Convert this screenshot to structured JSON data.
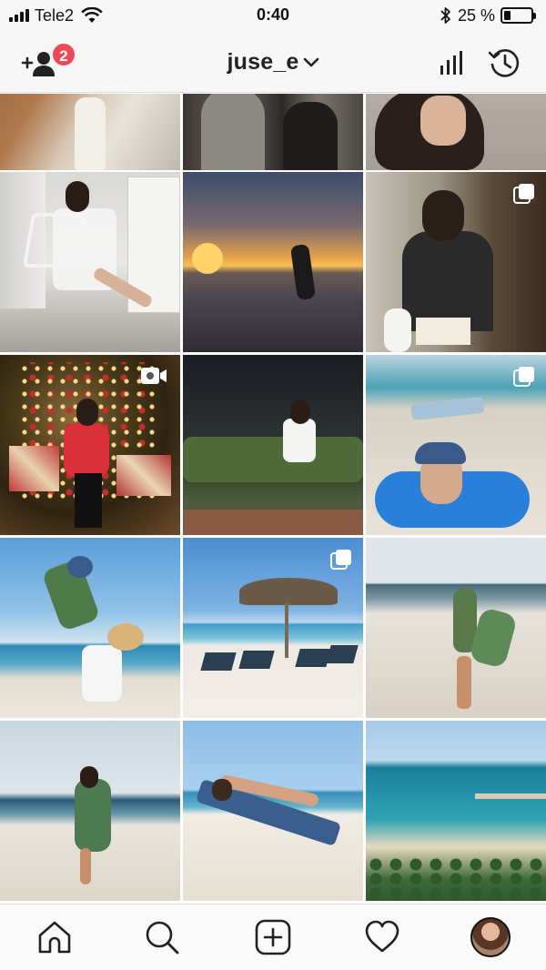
{
  "status_bar": {
    "carrier": "Tele2",
    "time": "0:40",
    "battery_percent": "25 %",
    "battery_level": 0.25
  },
  "header": {
    "username": "juse_e",
    "notification_count": "2",
    "icons": [
      "add-user-icon",
      "chevron-down-icon",
      "bar-chart-icon",
      "history-icon"
    ]
  },
  "grid": {
    "columns": 3,
    "posts": [
      {
        "row": 0,
        "col": 0,
        "desc": "interior",
        "type": "photo"
      },
      {
        "row": 0,
        "col": 1,
        "desc": "people",
        "type": "photo"
      },
      {
        "row": 0,
        "col": 2,
        "desc": "portrait",
        "type": "photo"
      },
      {
        "row": 1,
        "col": 0,
        "desc": "chair-portrait",
        "type": "photo"
      },
      {
        "row": 1,
        "col": 1,
        "desc": "sunset-beach",
        "type": "photo"
      },
      {
        "row": 1,
        "col": 2,
        "desc": "mirror-selfie",
        "type": "carousel"
      },
      {
        "row": 2,
        "col": 0,
        "desc": "christmas-tree",
        "type": "video"
      },
      {
        "row": 2,
        "col": 1,
        "desc": "night-palms",
        "type": "photo"
      },
      {
        "row": 2,
        "col": 2,
        "desc": "baby-pool",
        "type": "carousel"
      },
      {
        "row": 3,
        "col": 0,
        "desc": "father-child",
        "type": "photo"
      },
      {
        "row": 3,
        "col": 1,
        "desc": "beach-umbrella",
        "type": "carousel"
      },
      {
        "row": 3,
        "col": 2,
        "desc": "beach-arms-up",
        "type": "photo"
      },
      {
        "row": 4,
        "col": 0,
        "desc": "beach-walk",
        "type": "photo"
      },
      {
        "row": 4,
        "col": 1,
        "desc": "sunbed",
        "type": "photo"
      },
      {
        "row": 4,
        "col": 2,
        "desc": "coast-aerial",
        "type": "photo"
      }
    ]
  },
  "tabbar": {
    "items": [
      "home-icon",
      "search-icon",
      "add-post-icon",
      "heart-icon",
      "profile-avatar"
    ]
  }
}
